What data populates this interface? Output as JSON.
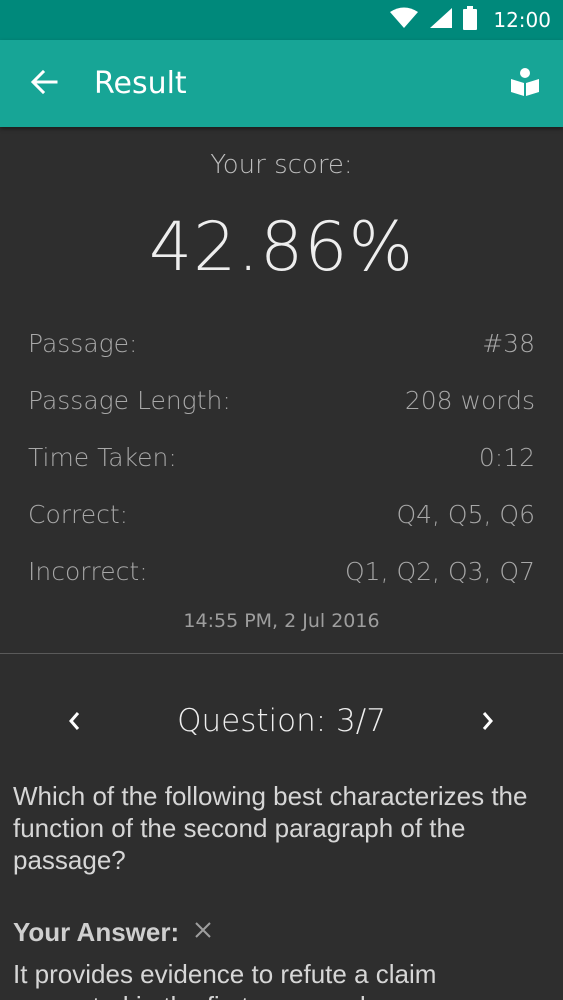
{
  "status_bar": {
    "time": "12:00",
    "icons": [
      "wifi-icon",
      "signal-icon",
      "battery-icon"
    ]
  },
  "app_bar": {
    "title": "Result",
    "back_icon": "arrow-left-icon",
    "action_icon": "book-reader-icon"
  },
  "score": {
    "label": "Your score:",
    "value": "42.86%"
  },
  "stats": [
    {
      "label": "Passage:",
      "value": "#38"
    },
    {
      "label": "Passage Length:",
      "value": "208 words"
    },
    {
      "label": "Time Taken:",
      "value": "0:12"
    },
    {
      "label": "Correct:",
      "value": "Q4, Q5, Q6"
    },
    {
      "label": "Incorrect:",
      "value": "Q1, Q2, Q3, Q7"
    }
  ],
  "timestamp": "14:55 PM, 2 Jul 2016",
  "question_nav": {
    "title": "Question: 3/7",
    "prev_icon": "chevron-left-icon",
    "next_icon": "chevron-right-icon"
  },
  "question": {
    "text": "Which of the following best characterizes the function of the second paragraph of the passage?",
    "answer_label": "Your Answer:",
    "answer_status_icon": "close-icon",
    "answer_text": "It provides evidence to refute a claim presented in the first paragraph."
  },
  "colors": {
    "status_bar": "#00897b",
    "app_bar": "#17a596",
    "background": "#2e2e2e"
  }
}
